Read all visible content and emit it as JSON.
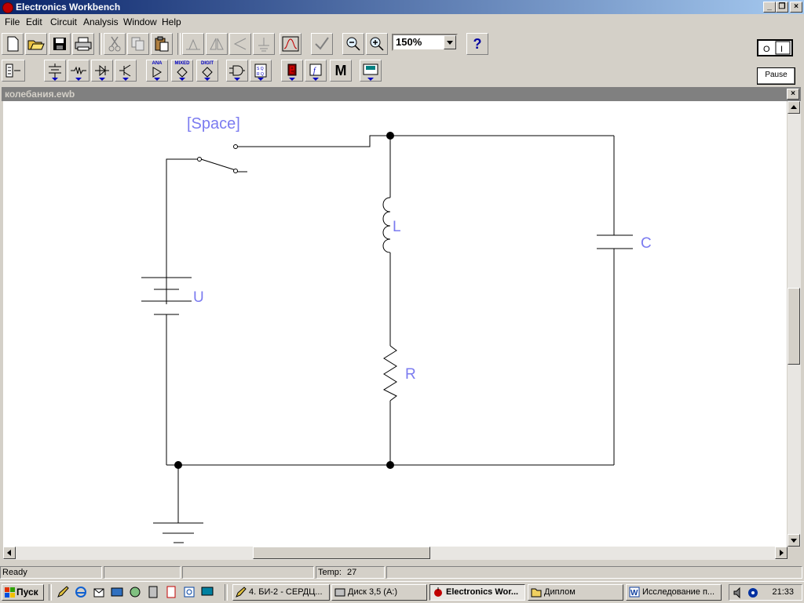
{
  "window": {
    "title": "Electronics Workbench"
  },
  "menu": [
    "File",
    "Edit",
    "Circuit",
    "Analysis",
    "Window",
    "Help"
  ],
  "toolbar": {
    "zoom_value": "150%",
    "pause_label": "Pause",
    "power_label": "O  I",
    "help_label": "?"
  },
  "parts_bin": {
    "analog_label": "ANA",
    "mixed_label": "MIXED",
    "digital_label": "DIGIT",
    "misc_label": "M"
  },
  "document": {
    "title": "колебания.ewb"
  },
  "circuit": {
    "switch_key": "[Space]",
    "components": {
      "battery": "U",
      "inductor": "L",
      "resistor": "R",
      "capacitor": "C"
    }
  },
  "status": {
    "ready": "Ready",
    "temp_label": "Temp:",
    "temp_value": "27"
  },
  "taskbar": {
    "start": "Пуск",
    "tasks": [
      "4. БИ-2 - СЕРДЦ...",
      "Диск 3,5 (A:)",
      "Electronics Wor...",
      "Диплом",
      "Исследование п..."
    ],
    "clock": "21:33"
  },
  "colors": {
    "title_start": "#0a246a",
    "title_end": "#a6caf0",
    "label_blue": "#7b7bf0"
  }
}
